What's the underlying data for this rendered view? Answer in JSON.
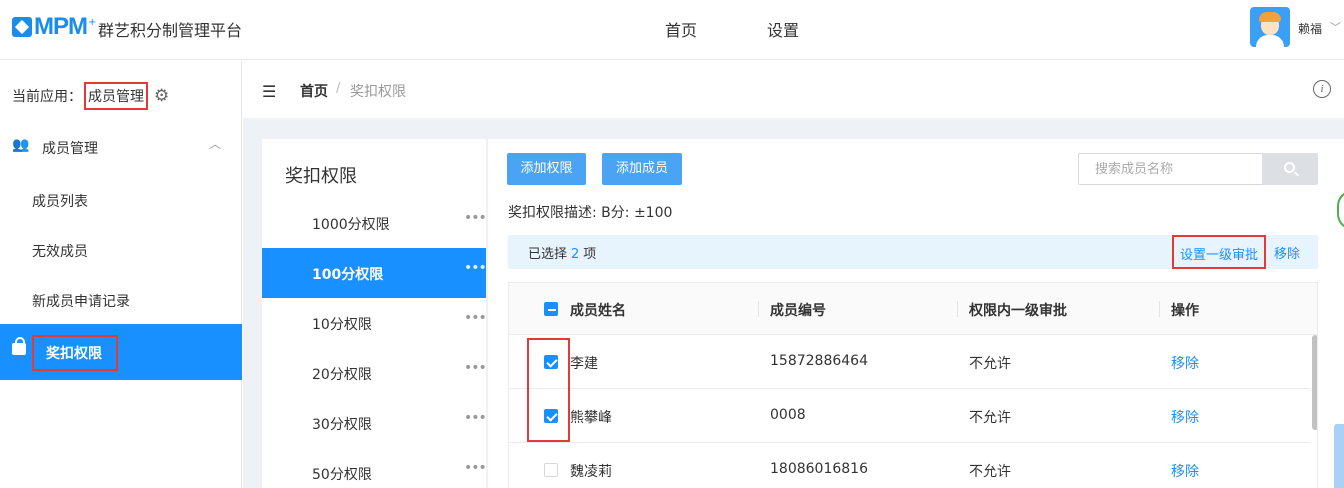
{
  "header": {
    "logo_text": "MPM",
    "logo_plus": "+",
    "app_title": "群艺积分制管理平台",
    "nav": [
      "首页",
      "设置"
    ],
    "username": "赖福",
    "caret": "﹀"
  },
  "sidebar": {
    "current_app_label": "当前应用：",
    "current_app_value": "成员管理",
    "gear": "⚙",
    "group_label": "成员管理",
    "group_icon": "👥",
    "group_chevron": "︿",
    "items": [
      "成员列表",
      "无效成员",
      "新成员申请记录"
    ],
    "active_item": "奖扣权限"
  },
  "breadcrumb": {
    "collapse_icon": "☰",
    "home": "首页",
    "sep": "/",
    "current": "奖扣权限",
    "info": "i"
  },
  "levels": {
    "title": "奖扣权限",
    "more": "•••",
    "items": [
      "1000分权限",
      "100分权限",
      "10分权限",
      "20分权限",
      "30分权限",
      "50分权限"
    ]
  },
  "toolbar": {
    "add_permission": "添加权限",
    "add_member": "添加成员",
    "search_placeholder": "搜索成员名称"
  },
  "description": "奖扣权限描述: B分: ±100",
  "selection": {
    "prefix": "已选择",
    "count": "2",
    "suffix": "项",
    "action_set_approval": "设置一级审批",
    "action_remove": "移除"
  },
  "table": {
    "headers": [
      "成员姓名",
      "成员编号",
      "权限内一级审批",
      "操作"
    ],
    "rows": [
      {
        "name": "李建",
        "id": "15872886464",
        "approval": "不允许",
        "op": "移除"
      },
      {
        "name": "熊攀峰",
        "id": "0008",
        "approval": "不允许",
        "op": "移除"
      },
      {
        "name": "魏凌莉",
        "id": "18086016816",
        "approval": "不允许",
        "op": "移除"
      }
    ]
  },
  "colors": {
    "primary": "#1890ff",
    "highlight": "#e53935"
  }
}
